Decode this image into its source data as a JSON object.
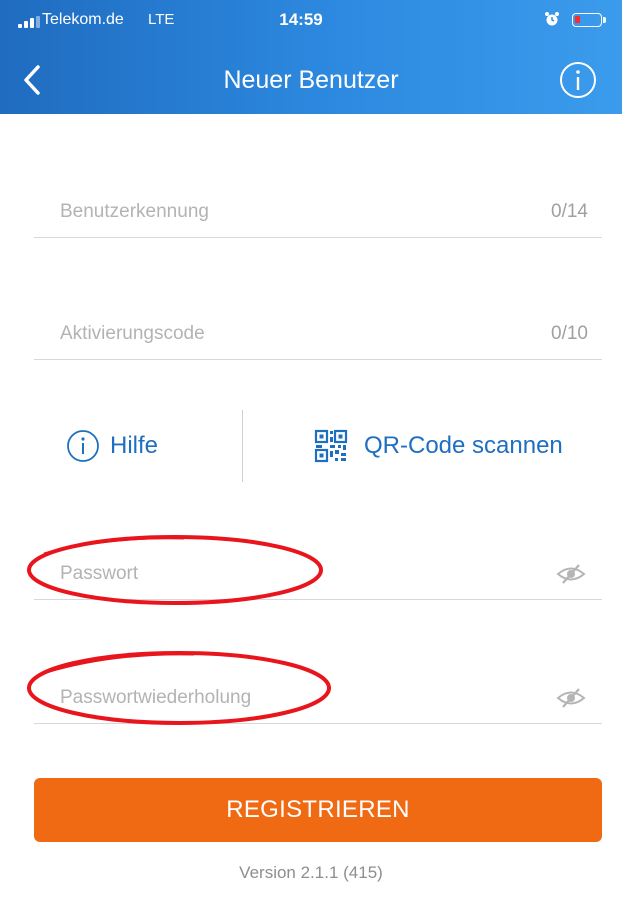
{
  "status_bar": {
    "carrier": "Telekom.de",
    "network": "LTE",
    "time": "14:59",
    "icons": [
      "signal-icon",
      "alarm-icon",
      "battery-icon"
    ]
  },
  "nav": {
    "title": "Neuer Benutzer",
    "back_icon": "chevron-left-icon",
    "info_icon": "info-icon"
  },
  "form": {
    "user_id": {
      "placeholder": "Benutzerkennung",
      "counter": "0/14"
    },
    "activation_code": {
      "placeholder": "Aktivierungscode",
      "counter": "0/10"
    },
    "password": {
      "placeholder": "Passwort",
      "icon": "eye-hidden-icon"
    },
    "password_repeat": {
      "placeholder": "Passwortwiederholung",
      "icon": "eye-hidden-icon"
    }
  },
  "actions": {
    "help_label": "Hilfe",
    "help_icon": "info-icon",
    "qr_label": "QR-Code scannen",
    "qr_icon": "qr-code-icon"
  },
  "register_label": "REGISTRIEREN",
  "version": "Version 2.1.1 (415)",
  "colors": {
    "header": "#2a82d8",
    "link": "#1f6fc1",
    "button": "#f06a14",
    "highlight": "#e8161c"
  }
}
